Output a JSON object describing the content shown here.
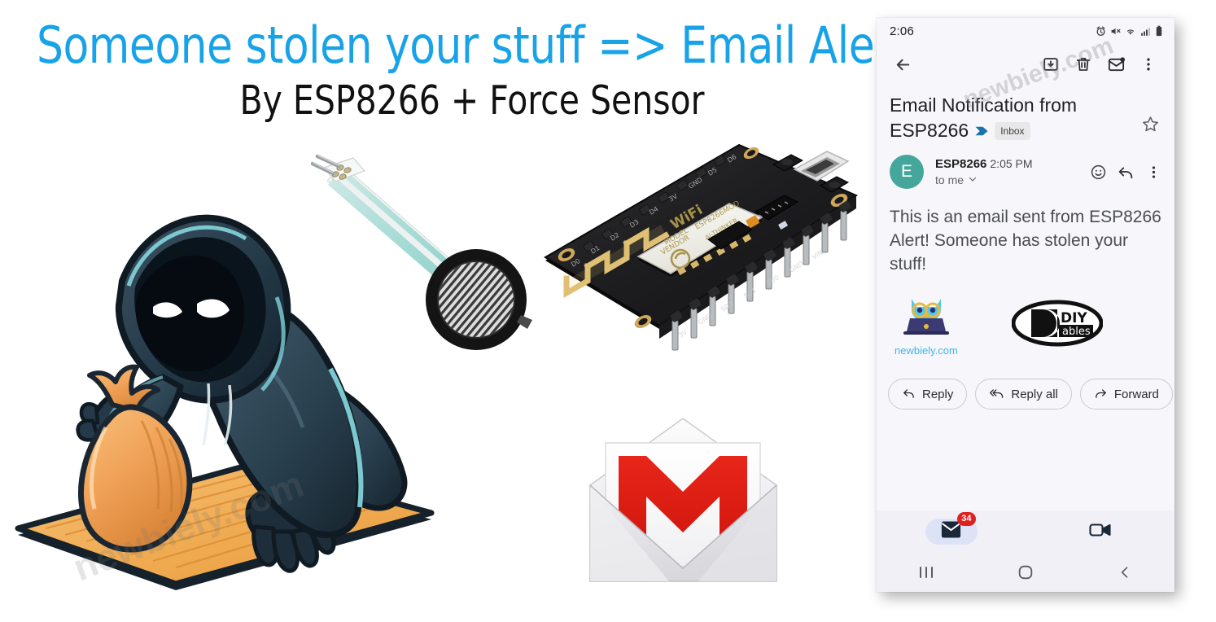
{
  "page": {
    "title": "Someone stolen your stuff => Email Alert",
    "subtitle": "By ESP8266 + Force Sensor",
    "title_color": "#18a3e8",
    "subtitle_color": "#111111",
    "watermark": "newbiely.com"
  },
  "illustrations": {
    "thief": "hooded-thief-with-loot-bag-on-table",
    "force_sensor": "force-sensitive-resistor-fsr",
    "board": "esp8266-nodemcu-board",
    "gmail": "gmail-open-envelope-icon"
  },
  "phone": {
    "statusbar": {
      "time": "2:06",
      "icons": [
        "alarm-icon",
        "mute-icon",
        "wifi-icon",
        "signal-icon",
        "battery-icon"
      ]
    },
    "toolbar": {
      "back": "back-arrow-icon",
      "archive": "archive-icon",
      "delete": "trash-icon",
      "unread": "mark-unread-icon",
      "more": "more-vertical-icon"
    },
    "email": {
      "subject_line1": "Email Notification from",
      "subject_line2": "ESP8266",
      "label": "Inbox",
      "star": "star-outline-icon",
      "avatar_letter": "E",
      "avatar_color": "#45a69b",
      "sender": "ESP8266",
      "time": "2:05 PM",
      "recipient": "to me",
      "body": "This is an email sent from ESP8266\nAlert! Someone has stolen your stuff!",
      "body_line1": "This is an email sent from ESP8266",
      "body_line2": "Alert! Someone has stolen your stuff!",
      "logo_newbiely": "newbiely.com",
      "logo_diyables_top": "DIY",
      "logo_diyables_bottom": "ables"
    },
    "actions": {
      "reply": "Reply",
      "reply_all": "Reply all",
      "forward": "Forward",
      "emoji": "emoji-icon"
    },
    "bottom_nav": {
      "mail_icon": "mail-icon",
      "mail_badge": "34",
      "meet_icon": "video-camera-icon"
    },
    "system_nav": {
      "recents": "recents-icon",
      "home": "home-icon",
      "back": "back-icon"
    }
  }
}
